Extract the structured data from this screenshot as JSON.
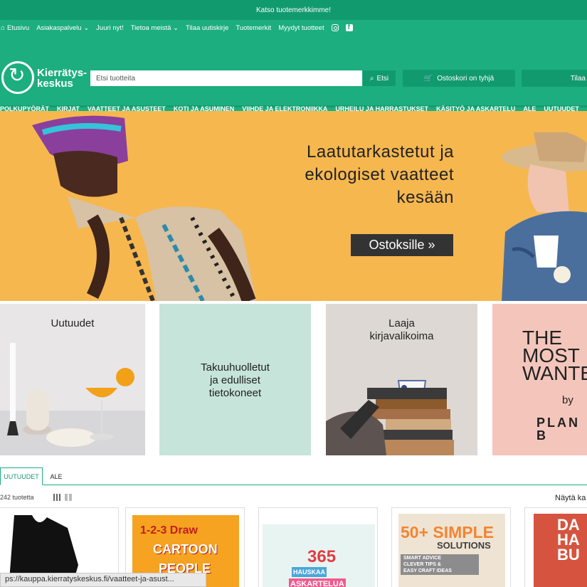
{
  "announcement": "Katso tuotemerkkimme!",
  "toplinks": [
    {
      "label": "Etusivu"
    },
    {
      "label": "Asiakaspalvelu ⌄"
    },
    {
      "label": "Juuri nyt!"
    },
    {
      "label": "Tietoa meistä ⌄"
    },
    {
      "label": "Tilaa uutiskirje"
    },
    {
      "label": "Tuotemerkit"
    },
    {
      "label": "Myydyt tuotteet"
    }
  ],
  "logo": {
    "line1": "Kierrätys-",
    "line2": "keskus"
  },
  "search": {
    "placeholder": "Etsi tuotteita",
    "button": "Etsi"
  },
  "cart": {
    "label": "Ostoskori on tyhjä"
  },
  "order": {
    "label": "Tilaa"
  },
  "categories": [
    "POLKUPYÖRÄT",
    "KIRJAT",
    "VAATTEET JA ASUSTEET",
    "KOTI JA ASUMINEN",
    "VIIHDE JA ELEKTRONIIKKA",
    "URHEILU JA HARRASTUKSET",
    "KÄSITYÖ JA ASKARTELU",
    "ALE",
    "UUTUUDET"
  ],
  "hero": {
    "line1": "Laatutarkastetut ja",
    "line2": "ekologiset vaatteet",
    "line3": "kesään",
    "button": "Ostoksille »"
  },
  "tiles": [
    {
      "title": "Uutuudet"
    },
    {
      "line1": "Takuuhuolletut",
      "line2": "ja edulliset",
      "line3": "tietokoneet"
    },
    {
      "line1": "Laaja",
      "line2": "kirjavalikoima"
    },
    {
      "line1": "THE",
      "line2": "MOST",
      "line3": "WANTED",
      "line4": "by",
      "line5": "PLAN B"
    }
  ],
  "tabs": [
    "UUTUUDET",
    "ALE"
  ],
  "product_count": "242 tuotetta",
  "show_label": "Näytä ka",
  "status_url": "ps://kauppa.kierratyskeskus.fi/vaatteet-ja-asust...",
  "cards": [
    {
      "name": "black-dress"
    },
    {
      "line1": "1-2-3 Draw",
      "line2": "CARTOON",
      "line3": "PEOPLE"
    },
    {
      "line1": "365",
      "line2": "HAUSKAA",
      "line3": "ASKARTELUA"
    },
    {
      "line1": "50+ SIMPLE",
      "line2": "SOLUTIONS",
      "line3": "SMART ADVICE",
      "line4": "CLEVER TIPS &",
      "line5": "EASY CRAFT IDEAS"
    },
    {
      "line1": "DA",
      "line2": "HA",
      "line3": "BU"
    }
  ],
  "colors": {
    "brand_green": "#1cae7e",
    "dark_green": "#129a6f",
    "hero_bg": "#f6b74f"
  }
}
